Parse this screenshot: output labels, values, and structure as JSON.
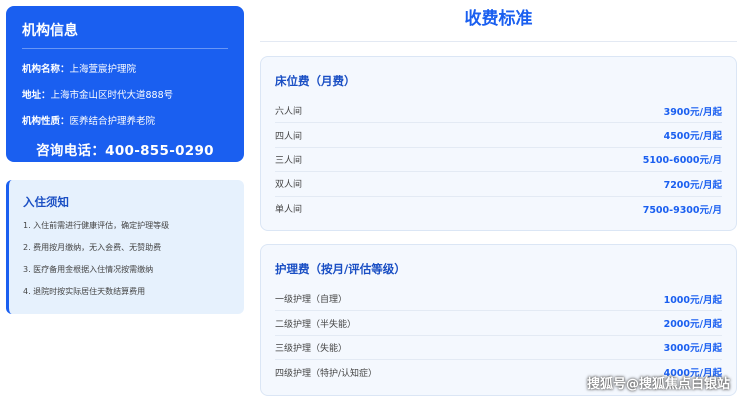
{
  "info": {
    "title": "机构信息",
    "name_label": "机构名称：",
    "name_value": "上海萱宸护理院",
    "address_label": "地址：",
    "address_value": "上海市金山区时代大道888号",
    "type_label": "机构性质：",
    "type_value": "医养结合护理养老院",
    "phone": "咨询电话：400-855-0290"
  },
  "notice": {
    "title": "入住须知",
    "items": [
      "1. 入住前需进行健康评估，确定护理等级",
      "2. 费用按月缴纳，无入会费、无赞助费",
      "3. 医疗备用金根据入住情况按需缴纳",
      "4. 退院时按实际居住天数结算费用"
    ]
  },
  "fees": {
    "title": "收费标准",
    "beds": {
      "title": "床位费（月费）",
      "rows": [
        {
          "name": "六人间",
          "price": "3900元/月起"
        },
        {
          "name": "四人间",
          "price": "4500元/月起"
        },
        {
          "name": "三人间",
          "price": "5100-6000元/月"
        },
        {
          "name": "双人间",
          "price": "7200元/月起"
        },
        {
          "name": "单人间",
          "price": "7500-9300元/月"
        }
      ]
    },
    "care": {
      "title": "护理费（按月/评估等级）",
      "rows": [
        {
          "name": "一级护理（自理）",
          "price": "1000元/月起"
        },
        {
          "name": "二级护理（半失能）",
          "price": "2000元/月起"
        },
        {
          "name": "三级护理（失能）",
          "price": "3000元/月起"
        },
        {
          "name": "四级护理（特护/认知症）",
          "price": "4000元/月起"
        }
      ]
    }
  },
  "watermark": "搜狐号@搜狐焦点白银站"
}
